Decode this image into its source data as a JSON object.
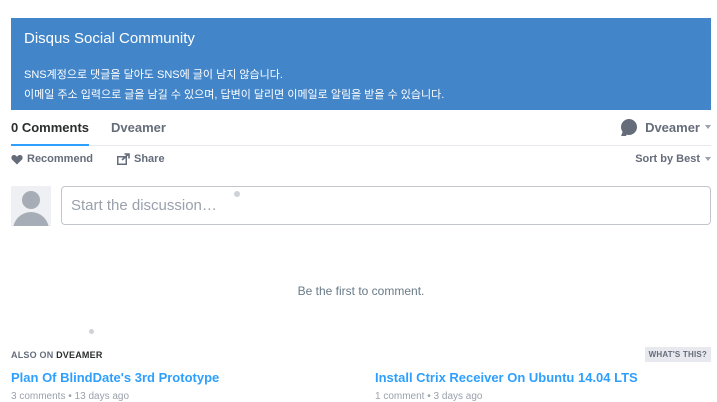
{
  "banner": {
    "title": "Disqus Social Community",
    "line1": "SNS계정으로 댓글을 달아도 SNS에 글이 남지 않습니다.",
    "line2": "이메일 주소 입력으로 글을 남길 수 있으며, 답변이 달리면 이메일로 알림을 받을 수 있습니다."
  },
  "tabs": {
    "comments": "0 Comments",
    "forum": "Dveamer",
    "user": "Dveamer"
  },
  "actions": {
    "recommend": "Recommend",
    "share": "Share",
    "sort": "Sort by Best"
  },
  "composer": {
    "placeholder": "Start the discussion…"
  },
  "empty_message": "Be the first to comment.",
  "also_on": {
    "prefix": "ALSO ON",
    "forum": "DVEAMER",
    "whats_this": "WHAT'S THIS?",
    "stories": [
      {
        "title": "Plan Of BlindDate's 3rd Prototype",
        "comments": "3 comments",
        "age": "13 days ago"
      },
      {
        "title": "Install Ctrix Receiver On Ubuntu 14.04 LTS",
        "comments": "1 comment",
        "age": "3 days ago"
      }
    ]
  },
  "colors": {
    "banner_bg": "#4285c9",
    "link_blue": "#2e9fff",
    "muted_text": "#656c7a"
  },
  "icons": {
    "user": "speech-bubble-icon",
    "recommend": "heart-icon",
    "share": "share-arrow-icon",
    "avatar": "default-avatar-icon"
  }
}
